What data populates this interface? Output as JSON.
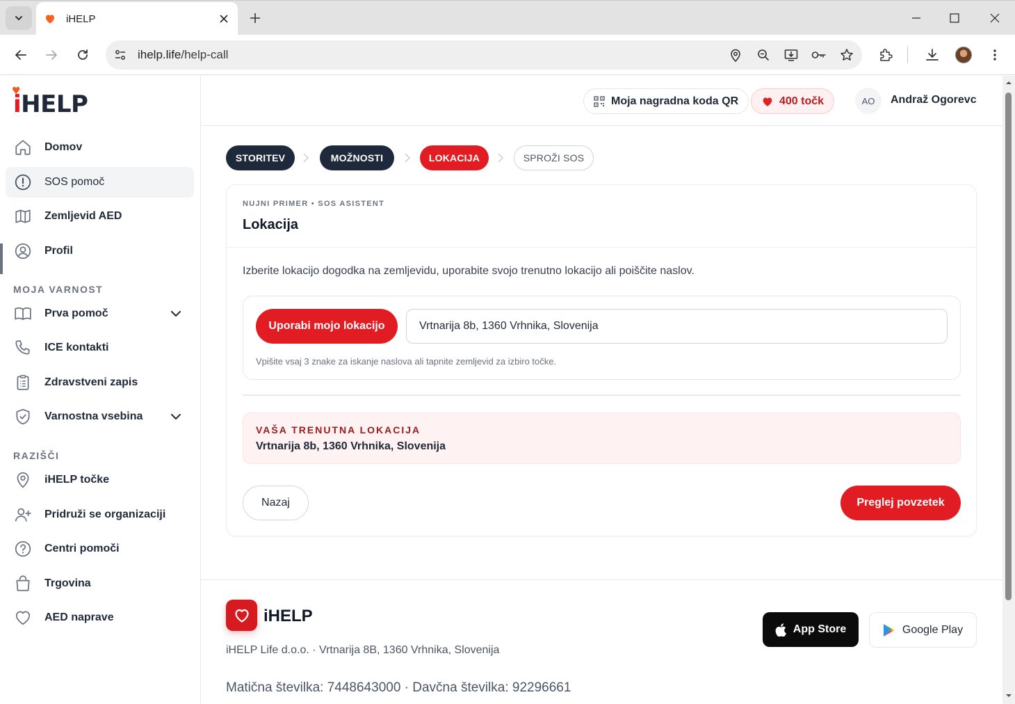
{
  "browser": {
    "tab_title": "iHELP",
    "url_host": "ihelp.life",
    "url_path": "/help-call"
  },
  "sidebar": {
    "logo": "HELP",
    "logo_i": "i",
    "items": [
      {
        "label": "Domov",
        "icon": "home-icon"
      },
      {
        "label": "SOS pomoč",
        "icon": "alert-circle-icon"
      },
      {
        "label": "Zemljevid AED",
        "icon": "map-icon"
      },
      {
        "label": "Profil",
        "icon": "user-circle-icon"
      }
    ],
    "section_safety": "MOJA VARNOST",
    "safety_items": [
      {
        "label": "Prva pomoč",
        "icon": "book-icon"
      },
      {
        "label": "ICE kontakti",
        "icon": "phone-icon"
      },
      {
        "label": "Zdravstveni zapis",
        "icon": "clipboard-icon"
      },
      {
        "label": "Varnostna vsebina",
        "icon": "shield-icon"
      }
    ],
    "section_explore": "RAZIŠČI",
    "explore_items": [
      {
        "label": "iHELP točke",
        "icon": "map-pin-icon"
      },
      {
        "label": "Pridruži se organizaciji",
        "icon": "user-plus-icon"
      },
      {
        "label": "Centri pomoči",
        "icon": "help-circle-icon"
      },
      {
        "label": "Trgovina",
        "icon": "shopping-bag-icon"
      },
      {
        "label": "AED naprave",
        "icon": "heart-icon"
      }
    ]
  },
  "header": {
    "qr_label": "Moja nagradna koda QR",
    "points_label": "400 točk",
    "user_initials": "AO",
    "user_name": "Andraž Ogorevc"
  },
  "steps": [
    "STORITEV",
    "MOŽNOSTI",
    "LOKACIJA",
    "SPROŽI SOS"
  ],
  "card": {
    "kicker": "NUJNI PRIMER • SOS ASISTENT",
    "title": "Lokacija",
    "intro": "Izberite lokacijo dogodka na zemljevidu, uporabite svojo trenutno lokacijo ali poiščite naslov.",
    "use_location_button": "Uporabi mojo lokacijo",
    "address_value": "Vrtnarija 8b, 1360 Vrhnika, Slovenija",
    "hint": "Vpišite vsaj 3 znake za iskanje naslova ali tapnite zemljevid za izbiro točke.",
    "current_label": "VAŠA TRENUTNA LOKACIJA",
    "current_value": "Vrtnarija 8b, 1360 Vrhnika, Slovenija",
    "back_button": "Nazaj",
    "next_button": "Preglej povzetek"
  },
  "footer": {
    "brand": "iHELP",
    "address": "iHELP Life d.o.o. · Vrtnarija 8B, 1360 Vrhnika, Slovenija",
    "ids": "Matična številka: 7448643000 · Davčna številka: 92296661",
    "app_store": "App Store",
    "google_play": "Google Play"
  },
  "colors": {
    "accent_red": "#e11d23",
    "dark_step": "#1e293b"
  }
}
